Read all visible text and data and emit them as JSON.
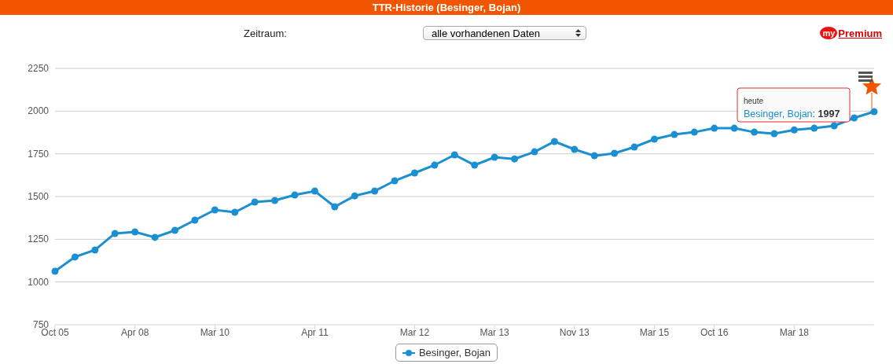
{
  "header": {
    "title": "TTR-Historie (Besinger, Bojan)"
  },
  "controls": {
    "label": "Zeitraum:",
    "select_value": "alle vorhandenen Daten"
  },
  "logo": {
    "prefix": "my",
    "word": "Premium"
  },
  "chart": {
    "chart_data": {
      "type": "line",
      "categories": [
        "Oct 05",
        null,
        null,
        null,
        "Apr 08",
        null,
        null,
        null,
        "Mar 10",
        null,
        null,
        null,
        null,
        "Apr 11",
        null,
        null,
        null,
        null,
        "Mar 12",
        null,
        null,
        null,
        "Mar 13",
        null,
        null,
        null,
        "Nov 13",
        null,
        null,
        null,
        "Mar 15",
        null,
        null,
        "Oct 16",
        null,
        null,
        null,
        "Mar 18",
        null,
        null,
        null,
        null
      ],
      "grid": true,
      "ylim": [
        750,
        2250
      ],
      "yticks": [
        750,
        1000,
        1250,
        1500,
        1750,
        2000,
        2250
      ],
      "series": [
        {
          "name": "Besinger, Bojan",
          "color": "#1a8fd1",
          "marker": true,
          "values": [
            1063,
            1146,
            1187,
            1284,
            1293,
            1261,
            1302,
            1362,
            1422,
            1408,
            1468,
            1477,
            1509,
            1532,
            1440,
            1504,
            1532,
            1592,
            1638,
            1684,
            1744,
            1684,
            1730,
            1720,
            1762,
            1822,
            1776,
            1739,
            1753,
            1790,
            1836,
            1863,
            1877,
            1900,
            1900,
            1877,
            1868,
            1890,
            1900,
            1914,
            1960,
            1997
          ]
        }
      ]
    },
    "tooltip": {
      "title": "heute",
      "name": "Besinger, Bojan",
      "separator": ":",
      "value": "1997"
    }
  }
}
